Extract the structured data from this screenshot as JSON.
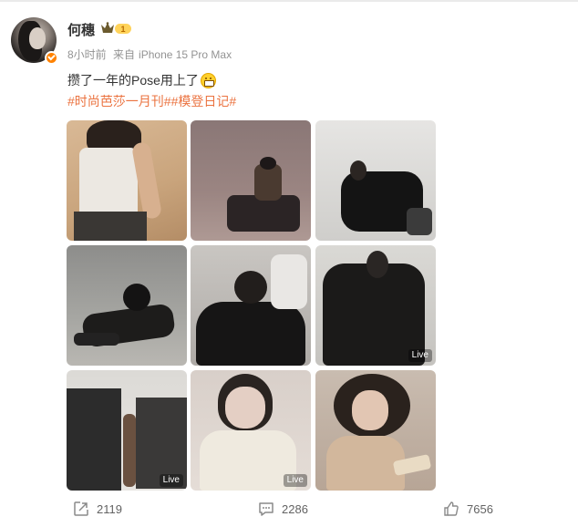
{
  "user": {
    "name": "何穗",
    "vip_level": "1"
  },
  "meta": {
    "time": "8小时前",
    "source_prefix": "来自",
    "device": "iPhone 15 Pro Max"
  },
  "post": {
    "text": "攒了一年的Pose用上了",
    "emoji": "grin-emoji",
    "tags": "#时尚芭莎一月刊##模登日记#"
  },
  "photos": [
    {
      "id": "photo-1",
      "live": ""
    },
    {
      "id": "photo-2",
      "live": ""
    },
    {
      "id": "photo-3",
      "live": ""
    },
    {
      "id": "photo-4",
      "live": ""
    },
    {
      "id": "photo-5",
      "live": ""
    },
    {
      "id": "photo-6",
      "live": "Live"
    },
    {
      "id": "photo-7",
      "live": "Live"
    },
    {
      "id": "photo-8",
      "live": "Live"
    },
    {
      "id": "photo-9",
      "live": ""
    }
  ],
  "actions": {
    "repost_count": "2119",
    "comment_count": "2286",
    "like_count": "7656"
  },
  "colors": {
    "accent": "#ff8200",
    "tag": "#eb7340",
    "meta_text": "#939393"
  }
}
